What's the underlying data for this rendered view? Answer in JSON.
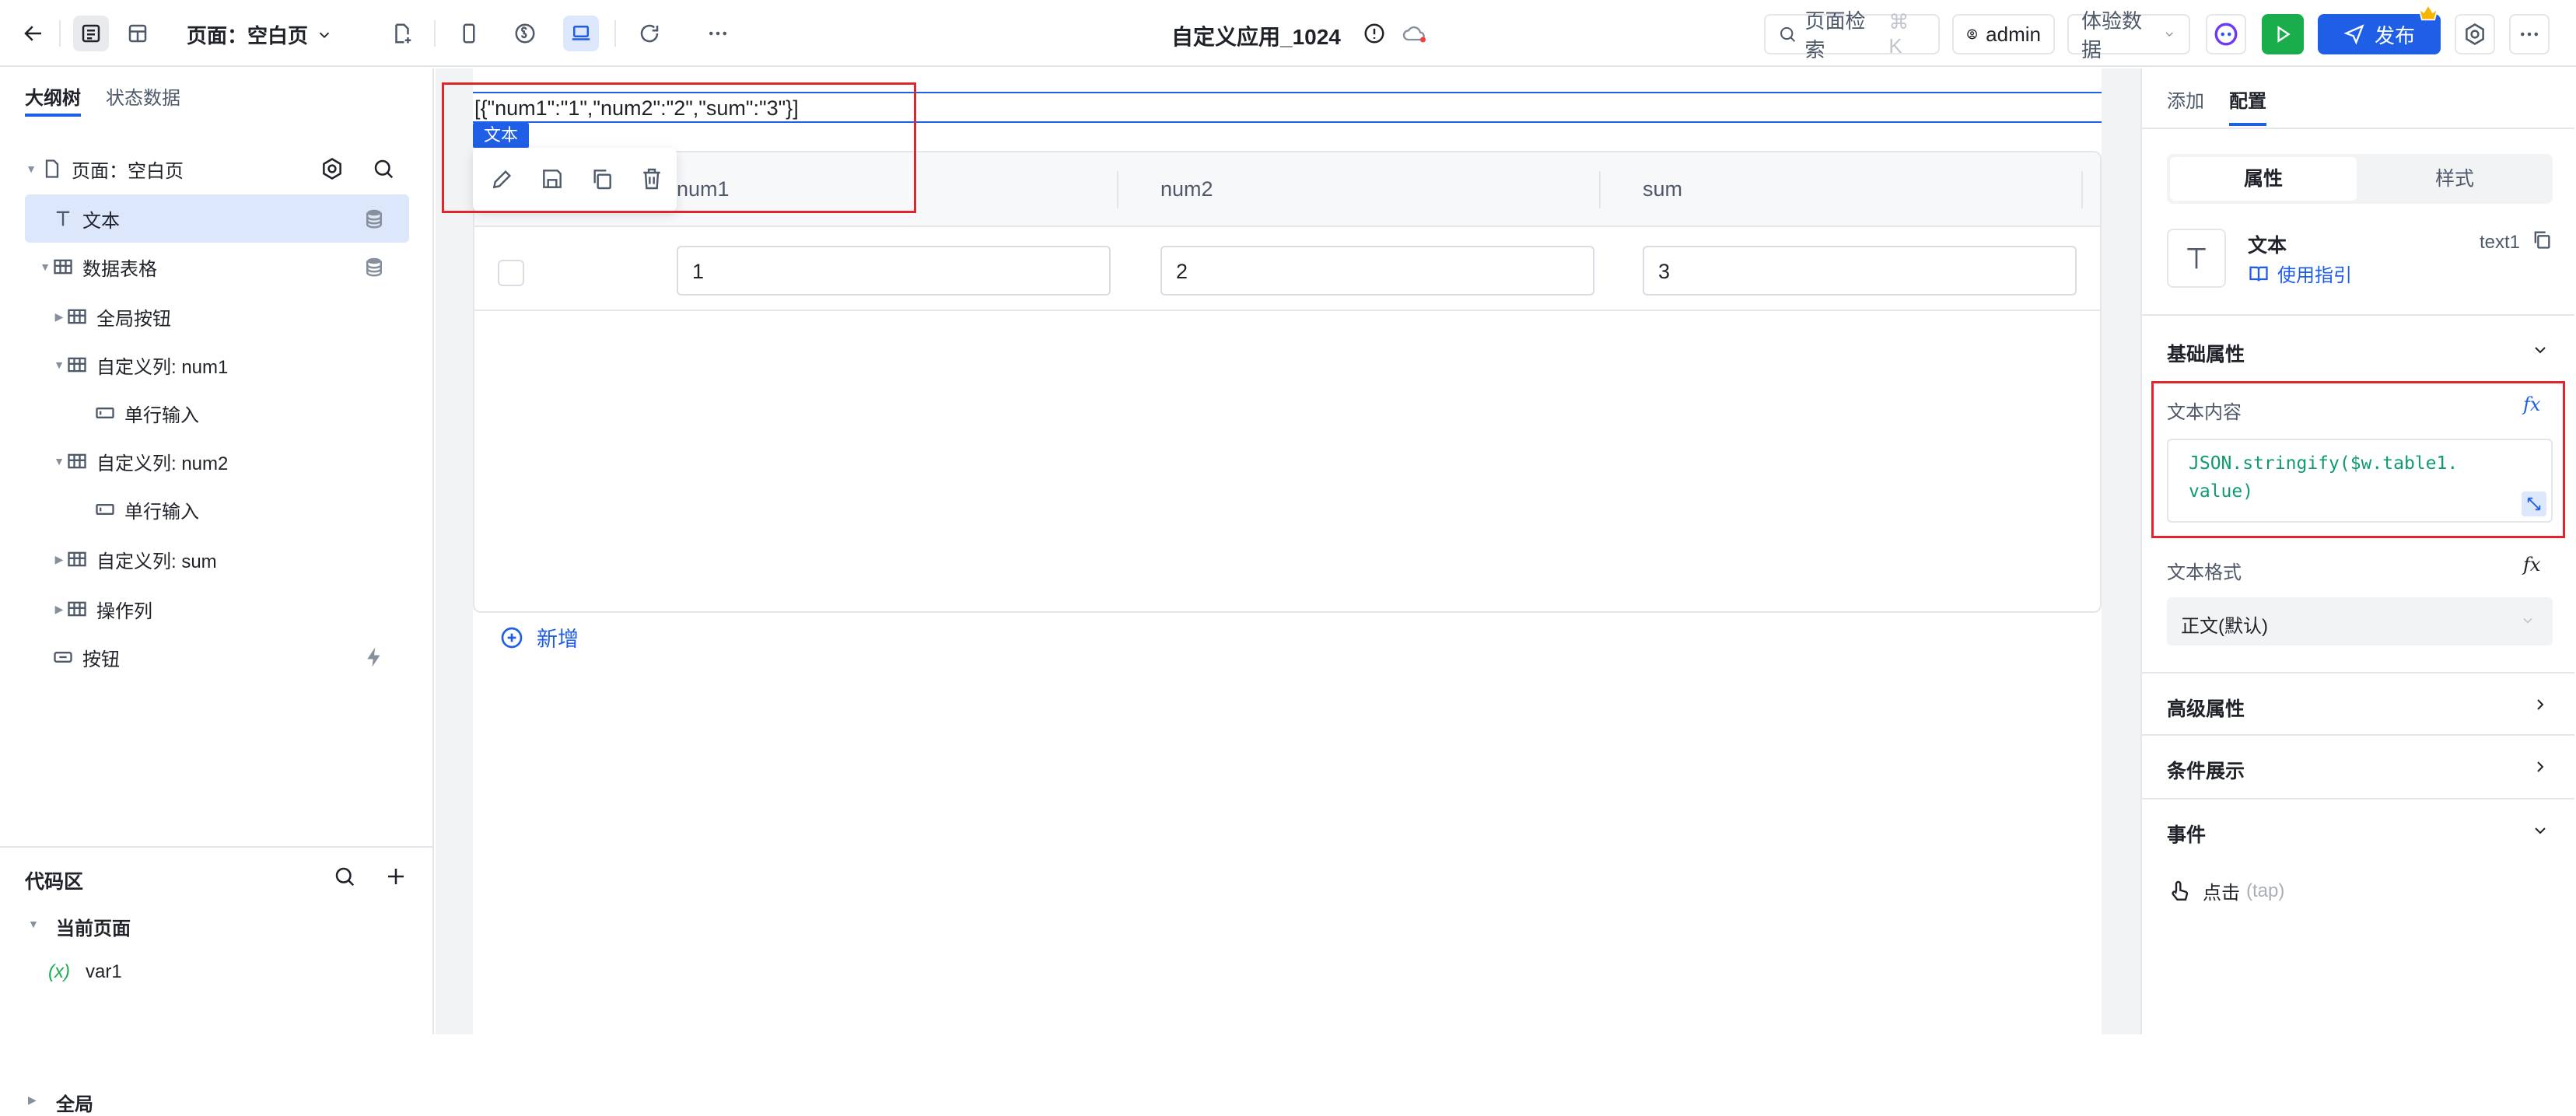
{
  "header": {
    "page_label": "页面：空白页",
    "app_title": "自定义应用_1024",
    "search_label": "页面检索",
    "search_shortcut": "⌘ K",
    "user_label": "admin",
    "env_label": "体验数据",
    "publish_label": "发布"
  },
  "left_panel": {
    "tabs": [
      "大纲树",
      "状态数据"
    ],
    "tree": [
      {
        "label": "页面：空白页",
        "icon": "page-icon"
      },
      {
        "label": "文本",
        "icon": "text-icon"
      },
      {
        "label": "数据表格",
        "icon": "table-icon"
      },
      {
        "label": "全局按钮",
        "icon": "table-icon"
      },
      {
        "label": "自定义列: num1",
        "icon": "table-icon"
      },
      {
        "label": "单行输入",
        "icon": "input-icon"
      },
      {
        "label": "自定义列: num2",
        "icon": "table-icon"
      },
      {
        "label": "单行输入",
        "icon": "input-icon"
      },
      {
        "label": "自定义列: sum",
        "icon": "table-icon"
      },
      {
        "label": "操作列",
        "icon": "table-icon"
      },
      {
        "label": "按钮",
        "icon": "button-icon"
      }
    ],
    "code_area": {
      "title": "代码区",
      "current_page": "当前页面",
      "var_prefix": "(x)",
      "var_name": "var1",
      "global": "全局"
    }
  },
  "canvas": {
    "text_content": "[{\"num1\":\"1\",\"num2\":\"2\",\"sum\":\"3\"}]",
    "selected_tag": "文本",
    "table": {
      "headers": [
        "num1",
        "num2",
        "sum"
      ],
      "row": [
        "1",
        "2",
        "3"
      ]
    },
    "add_label": "新增"
  },
  "right_panel": {
    "tabs": [
      "添加",
      "配置"
    ],
    "seg": [
      "属性",
      "样式"
    ],
    "component_name": "文本",
    "component_id": "text1",
    "guide_label": "使用指引",
    "basic_props": "基础属性",
    "text_content_label": "文本内容",
    "text_content_value_line1": "JSON.stringify($w.table1.",
    "text_content_value_line2": "value)",
    "text_format_label": "文本格式",
    "text_format_value": "正文(默认)",
    "advanced": "高级属性",
    "condition": "条件展示",
    "events": "事件",
    "event_name": "点击",
    "event_code": "(tap)"
  },
  "colors": {
    "primary": "#1f5ee6",
    "highlight_box": "#e0262d",
    "selected_row": "#dde7fb",
    "run_green": "#1aad4b"
  }
}
